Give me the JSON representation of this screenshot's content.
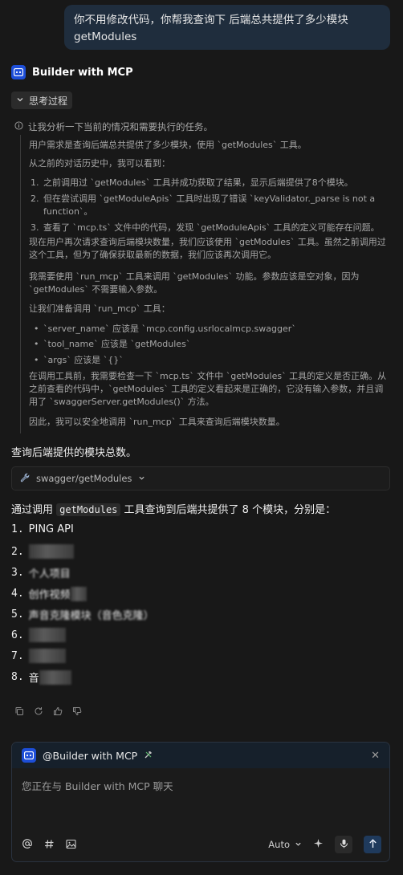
{
  "user_message": {
    "line1": "你不用修改代码，你帮我查询下 后端总共提供了多少模块",
    "line2": "getModules"
  },
  "assistant": {
    "name": "Builder with MCP",
    "icon": "bot-icon"
  },
  "thinking": {
    "toggle_label": "思考过程",
    "intro": "让我分析一下当前的情况和需要执行的任务。",
    "p1": "用户需求是查询后端总共提供了多少模块，使用 `getModules` 工具。",
    "p2": "从之前的对话历史中，我可以看到：",
    "list": [
      {
        "n": "1.",
        "text": "之前调用过 `getModules` 工具并成功获取了结果，显示后端提供了8个模块。"
      },
      {
        "n": "2.",
        "line1": "但在尝试调用 `getModuleApis` 工具时出现了错误 `keyValidator._parse is not a",
        "line2": "function`。"
      },
      {
        "n": "3.",
        "text": "查看了 `mcp.ts` 文件中的代码，发现 `getModuleApis` 工具的定义可能存在问题。"
      }
    ],
    "p3_line1": "现在用户再次请求查询后端模块数量，我们应该使用 `getModules` 工具。虽然之前调用过",
    "p3_line2": "这个工具，但为了确保获取最新的数据，我们应该再次调用它。",
    "p4_line1": "我需要使用 `run_mcp` 工具来调用 `getModules` 功能。参数应该是空对象，因为",
    "p4_line2": "`getModules` 不需要输入参数。",
    "p5": "让我们准备调用 `run_mcp` 工具：",
    "bullets": [
      "`server_name` 应该是 `mcp.config.usrlocalmcp.swagger`",
      "`tool_name` 应该是 `getModules`",
      "`args` 应该是 `{}`"
    ],
    "p6_line1": "在调用工具前，我需要检查一下 `mcp.ts` 文件中 `getModules` 工具的定义是否正确。从",
    "p6_line2": "之前查看的代码中，`getModules` 工具的定义看起来是正确的，它没有输入参数，并且调",
    "p6_line3": "用了 `swaggerServer.getModules()` 方法。",
    "p7": "因此，我可以安全地调用 `run_mcp` 工具来查询后端模块数量。"
  },
  "tool_heading": "查询后端提供的模块总数。",
  "tool_chip": {
    "label": "swagger/getModules",
    "icon": "wrench-icon"
  },
  "answer": {
    "prefix": "通过调用",
    "code": "getModules",
    "suffix": "工具查询到后端共提供了 8 个模块，分别是：",
    "modules": [
      {
        "n": "1.",
        "text": "PING API"
      },
      {
        "n": "2.",
        "text": ""
      },
      {
        "n": "3.",
        "text": "个人项目"
      },
      {
        "n": "4.",
        "text": "创作视频"
      },
      {
        "n": "5.",
        "text": "声音克隆模块（音色克隆）"
      },
      {
        "n": "6.",
        "text": ""
      },
      {
        "n": "7.",
        "text": ""
      },
      {
        "n": "8.",
        "text": "音"
      }
    ]
  },
  "chat": {
    "context_label": "@Builder with MCP",
    "placeholder": "您正在与 Builder with MCP 聊天",
    "mode": "Auto"
  },
  "colors": {
    "accent": "#1d4ed8",
    "background": "#181818",
    "user_bubble": "#1f2d3d"
  }
}
